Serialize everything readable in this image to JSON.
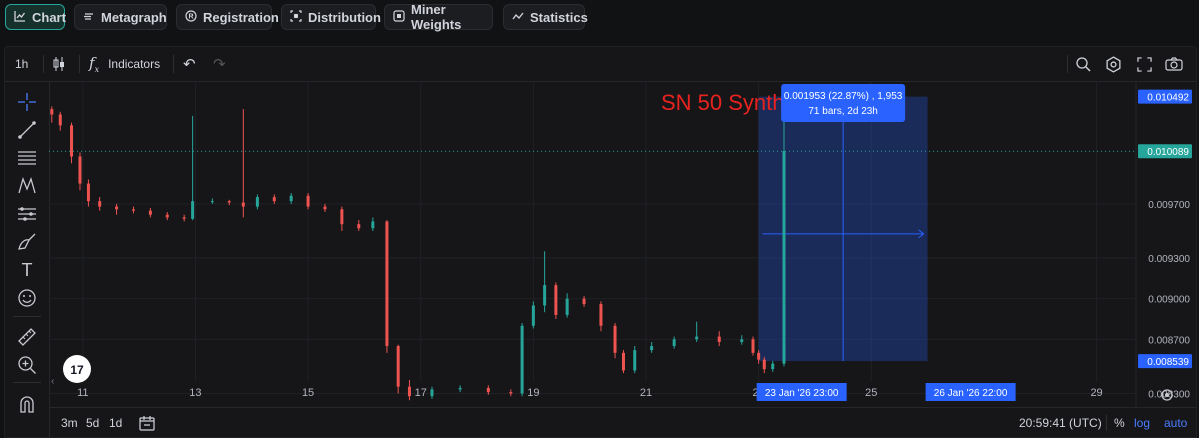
{
  "nav": [
    {
      "label": "Chart",
      "icon": "chart-icon",
      "active": true
    },
    {
      "label": "Metagraph",
      "icon": "metagraph-icon"
    },
    {
      "label": "Registration",
      "icon": "registration-icon"
    },
    {
      "label": "Distribution",
      "icon": "distribution-icon"
    },
    {
      "label": "Miner Weights",
      "icon": "miner-weights-icon"
    },
    {
      "label": "Statistics",
      "icon": "statistics-icon"
    }
  ],
  "toolbar": {
    "interval": "1h",
    "indicators": "Indicators"
  },
  "chart_title": "SN 50 Synth",
  "measure": {
    "line1": "0.001953 (22.87%) , 1,953",
    "line2": "71 bars, 2d 23h"
  },
  "price_axis": {
    "ticks": [
      "0.009700",
      "0.009300",
      "0.009000",
      "0.008700",
      "0.008300"
    ],
    "top_label": "0.010492",
    "current_label": "0.010089",
    "bottom_label": "0.008539"
  },
  "time_axis": {
    "ticks": [
      "11",
      "13",
      "15",
      "17",
      "19",
      "21",
      "23",
      "25",
      "29"
    ],
    "label_start": "23 Jan '26   23:00",
    "label_end": "26 Jan '26   22:00"
  },
  "bottom": {
    "ranges": [
      "3m",
      "5d",
      "1d"
    ],
    "clock": "20:59:41 (UTC)",
    "percent": "%",
    "log": "log",
    "auto": "auto"
  },
  "colors": {
    "up": "#26a69a",
    "down": "#ef5350",
    "accent": "#2962ff",
    "title": "#e8231f"
  },
  "chart_data": {
    "type": "candlestick",
    "title": "SN 50 Synth",
    "x_range_days": [
      10.4,
      29.7
    ],
    "ylim": [
      0.0082,
      0.0106
    ],
    "candles": [
      [
        10.45,
        0.0104,
        0.01036,
        0.01042,
        0.0103
      ],
      [
        10.6,
        0.01036,
        0.01028,
        0.01038,
        0.01024
      ],
      [
        10.8,
        0.01028,
        0.01005,
        0.0103,
        0.01
      ],
      [
        10.95,
        0.01005,
        0.00985,
        0.01008,
        0.0098
      ],
      [
        11.1,
        0.00985,
        0.00972,
        0.00988,
        0.00968
      ],
      [
        11.3,
        0.00972,
        0.00968,
        0.00975,
        0.00965
      ],
      [
        11.6,
        0.00968,
        0.00966,
        0.0097,
        0.00962
      ],
      [
        11.9,
        0.00966,
        0.00965,
        0.00968,
        0.00963
      ],
      [
        12.2,
        0.00965,
        0.00962,
        0.00967,
        0.0096
      ],
      [
        12.5,
        0.00962,
        0.0096,
        0.00964,
        0.00958
      ],
      [
        12.8,
        0.0096,
        0.00959,
        0.00962,
        0.00957
      ],
      [
        12.95,
        0.00959,
        0.00972,
        0.01035,
        0.00958
      ],
      [
        13.3,
        0.00972,
        0.00972,
        0.00974,
        0.0097
      ],
      [
        13.6,
        0.00972,
        0.00971,
        0.00973,
        0.00969
      ],
      [
        13.85,
        0.00971,
        0.00968,
        0.0104,
        0.0096
      ],
      [
        14.1,
        0.00968,
        0.00975,
        0.00977,
        0.00966
      ],
      [
        14.4,
        0.00975,
        0.00972,
        0.00977,
        0.0097
      ],
      [
        14.7,
        0.00972,
        0.00976,
        0.00978,
        0.0097
      ],
      [
        15.0,
        0.00976,
        0.00968,
        0.00978,
        0.00966
      ],
      [
        15.3,
        0.00968,
        0.00966,
        0.0097,
        0.00964
      ],
      [
        15.6,
        0.00966,
        0.00955,
        0.00968,
        0.0095
      ],
      [
        15.9,
        0.00955,
        0.00952,
        0.00958,
        0.0095
      ],
      [
        16.15,
        0.00952,
        0.00957,
        0.0096,
        0.0095
      ],
      [
        16.4,
        0.00957,
        0.00865,
        0.00958,
        0.0086
      ],
      [
        16.6,
        0.00865,
        0.00835,
        0.00866,
        0.0083
      ],
      [
        16.8,
        0.00835,
        0.00828,
        0.0084,
        0.00825
      ],
      [
        17.2,
        0.00828,
        0.00833,
        0.00835,
        0.00826
      ],
      [
        17.7,
        0.00833,
        0.00834,
        0.00836,
        0.00831
      ],
      [
        18.2,
        0.00834,
        0.00831,
        0.00836,
        0.00829
      ],
      [
        18.6,
        0.00831,
        0.0083,
        0.00833,
        0.00828
      ],
      [
        18.8,
        0.0083,
        0.0088,
        0.00882,
        0.00828
      ],
      [
        19.0,
        0.0088,
        0.00895,
        0.00898,
        0.00878
      ],
      [
        19.2,
        0.00895,
        0.0091,
        0.00935,
        0.0089
      ],
      [
        19.4,
        0.0091,
        0.00888,
        0.00912,
        0.00885
      ],
      [
        19.6,
        0.00888,
        0.009,
        0.00904,
        0.00886
      ],
      [
        19.9,
        0.009,
        0.00896,
        0.00902,
        0.00894
      ],
      [
        20.2,
        0.00896,
        0.0088,
        0.00898,
        0.00876
      ],
      [
        20.45,
        0.0088,
        0.0086,
        0.00882,
        0.00856
      ],
      [
        20.6,
        0.0086,
        0.00847,
        0.00862,
        0.00845
      ],
      [
        20.8,
        0.00847,
        0.00862,
        0.00865,
        0.00845
      ],
      [
        21.1,
        0.00862,
        0.00865,
        0.00868,
        0.0086
      ],
      [
        21.5,
        0.00865,
        0.0087,
        0.00872,
        0.00863
      ],
      [
        21.9,
        0.0087,
        0.00872,
        0.00883,
        0.00868
      ],
      [
        22.3,
        0.00872,
        0.00868,
        0.00876,
        0.00865
      ],
      [
        22.7,
        0.00868,
        0.0087,
        0.00873,
        0.00866
      ],
      [
        22.9,
        0.0087,
        0.0086,
        0.00872,
        0.00858
      ],
      [
        23.0,
        0.0086,
        0.00855,
        0.00862,
        0.00852
      ],
      [
        23.1,
        0.00855,
        0.00848,
        0.00857,
        0.00845
      ],
      [
        23.25,
        0.00848,
        0.00852,
        0.00854,
        0.00846
      ],
      [
        23.45,
        0.00852,
        0.01009,
        0.01049,
        0.0085
      ]
    ],
    "current_price": 0.010089,
    "measure": {
      "from_day": 23.0,
      "to_day": 26.0,
      "low": 0.008539,
      "high": 0.010492,
      "change": "0.001953 (22.87%)",
      "bars": 71
    }
  }
}
